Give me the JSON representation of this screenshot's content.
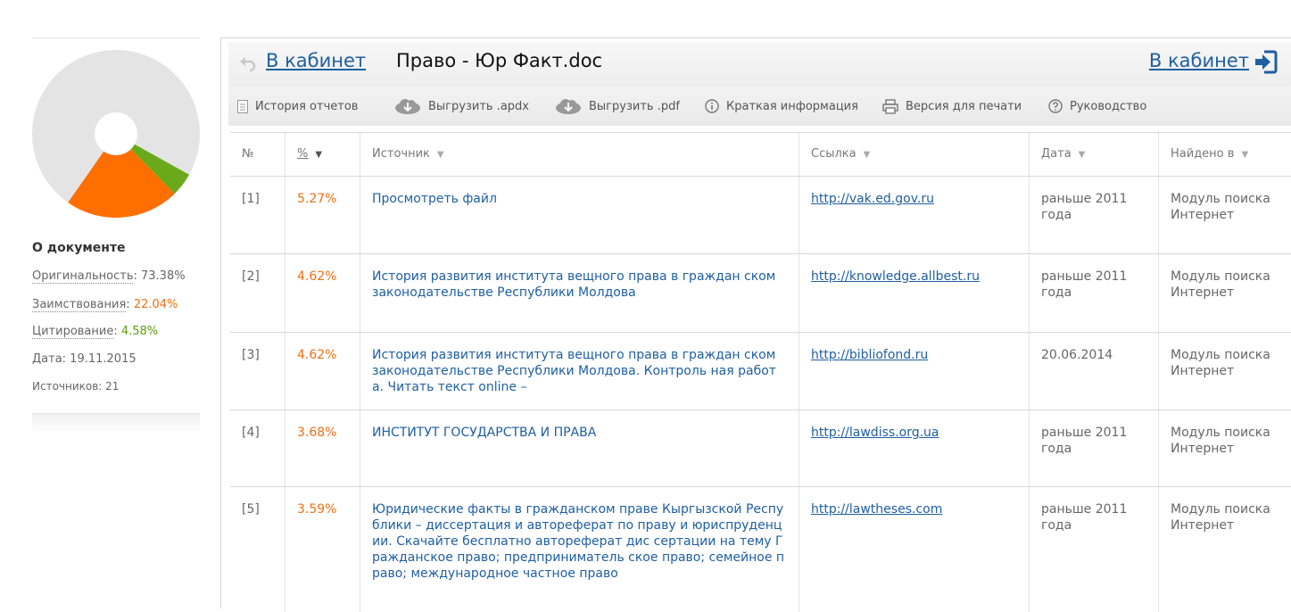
{
  "colors": {
    "accent": "#1f5fa0",
    "orange": "#ef6f16",
    "green": "#5a9e0f",
    "grey": "#e4e4e4"
  },
  "pie": {
    "segments": [
      {
        "name": "Оригинальность",
        "value": 73.38,
        "color": "#e4e4e4"
      },
      {
        "name": "Заимствования",
        "value": 22.04,
        "color": "#ff6e00"
      },
      {
        "name": "Цитирование",
        "value": 4.58,
        "color": "#6aaa1a"
      }
    ]
  },
  "doc_info": {
    "title": "О документе",
    "originality_label": "Оригинальность",
    "originality_value": "73.38%",
    "borrowing_label": "Заимствования",
    "borrowing_value": "22.04%",
    "citation_label": "Цитирование",
    "citation_value": "4.58%",
    "date_text": "Дата: 19.11.2015",
    "sources_text": "Источников: 21"
  },
  "header": {
    "back_label": "В кабинет",
    "doc_title": "Право - Юр Факт.doc",
    "back_right_label": "В кабинет"
  },
  "toolbar": {
    "history": "История отчетов",
    "export_apdx": "Выгрузить .apdx",
    "export_pdf": "Выгрузить .pdf",
    "brief": "Краткая информация",
    "print": "Версия для печати",
    "guide": "Руководство"
  },
  "table": {
    "headers": {
      "num": "№",
      "pct": "%",
      "source": "Источник",
      "link": "Ссылка",
      "date": "Дата",
      "found": "Найдено в"
    },
    "rows": [
      {
        "num": "[1]",
        "pct": "5.27%",
        "source": "Просмотреть файл",
        "link": "http://vak.ed.gov.ru",
        "date": "раньше 2011 года",
        "found": "Модуль поиска Интернет"
      },
      {
        "num": "[2]",
        "pct": "4.62%",
        "source": "История развития института вещного права в граждан ском законодательстве Республики Молдова",
        "link": "http://knowledge.allbest.ru",
        "date": "раньше 2011 года",
        "found": "Модуль поиска Интернет"
      },
      {
        "num": "[3]",
        "pct": "4.62%",
        "source": "История развития института вещного права в граждан ском законодательстве Республики Молдова. Контроль ная работа. Читать текст online –",
        "link": "http://bibliofond.ru",
        "date": "20.06.2014",
        "found": "Модуль поиска Интернет"
      },
      {
        "num": "[4]",
        "pct": "3.68%",
        "source": "ИНСТИТУТ ГОСУДАРСТВА И ПРАВА",
        "link": "http://lawdiss.org.ua",
        "date": "раньше 2011 года",
        "found": "Модуль поиска Интернет"
      },
      {
        "num": "[5]",
        "pct": "3.59%",
        "source": "Юридические факты в гражданском праве Кыргызской Республики – диссертация и автореферат по праву и юриспруденции. Скачайте бесплатно автореферат дис сертации на тему Гражданское право; предприниматель ское право; семейное право; международное частное право",
        "link": "http://lawtheses.com",
        "date": "раньше 2011 года",
        "found": "Модуль поиска Интернет"
      }
    ]
  }
}
